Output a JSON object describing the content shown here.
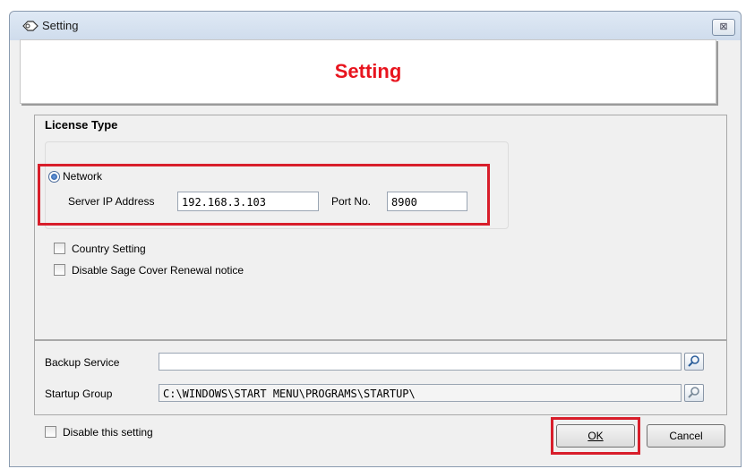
{
  "window": {
    "title": "Setting",
    "close_glyph": "⊠"
  },
  "banner": {
    "title": "Setting",
    "title_color": "#e8141e"
  },
  "license": {
    "heading": "License Type",
    "network_label": "Network",
    "network_selected": true,
    "server_ip_label": "Server IP Address",
    "server_ip_value": "192.168.3.103",
    "port_label": "Port No.",
    "port_value": "8900"
  },
  "options": {
    "country_setting": {
      "label": "Country Setting",
      "checked": false
    },
    "disable_sage": {
      "label": "Disable Sage Cover Renewal notice",
      "checked": false
    }
  },
  "backup": {
    "label": "Backup Service",
    "value": ""
  },
  "startup": {
    "label": "Startup Group",
    "value": "C:\\WINDOWS\\START MENU\\PROGRAMS\\STARTUP\\"
  },
  "footer": {
    "disable_setting": {
      "label": "Disable this setting",
      "checked": false
    },
    "ok_label": "OK",
    "cancel_label": "Cancel"
  },
  "highlight_color": "#d81e2b",
  "icons": {
    "title": "key-icon",
    "browse": "search-icon"
  }
}
